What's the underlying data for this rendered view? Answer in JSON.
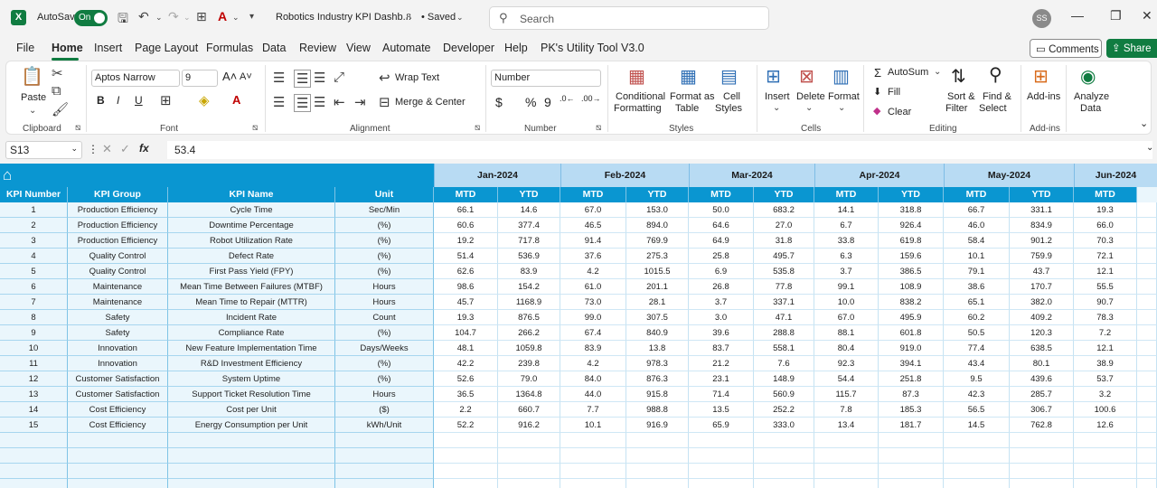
{
  "titlebar": {
    "autosave_label": "AutoSave",
    "toggle_label": "On",
    "title": "Robotics Industry KPI Dashb...",
    "saved": "• Saved",
    "search_placeholder": "Search",
    "avatar_initials": "SS"
  },
  "tabs": [
    "File",
    "Home",
    "Insert",
    "Page Layout",
    "Formulas",
    "Data",
    "Review",
    "View",
    "Automate",
    "Developer",
    "Help",
    "PK's Utility Tool V3.0"
  ],
  "active_tab": "Home",
  "comments_label": "Comments",
  "share_label": "Share",
  "ribbon": {
    "paste": "Paste",
    "font_name": "Aptos Narrow",
    "font_size": "9",
    "wrap_text": "Wrap Text",
    "merge_center": "Merge & Center",
    "number_format": "Number",
    "conditional_formatting": [
      "Conditional",
      "Formatting"
    ],
    "format_as_table": [
      "Format as",
      "Table"
    ],
    "cell_styles": [
      "Cell",
      "Styles"
    ],
    "insert": "Insert",
    "delete": "Delete",
    "format": "Format",
    "autosum": "AutoSum",
    "fill": "Fill",
    "clear": "Clear",
    "sort_filter": [
      "Sort &",
      "Filter"
    ],
    "find_select": [
      "Find &",
      "Select"
    ],
    "addins": "Add-ins",
    "analyze_data": [
      "Analyze",
      "Data"
    ],
    "groups": [
      "Clipboard",
      "Font",
      "Alignment",
      "Number",
      "Styles",
      "Cells",
      "Editing",
      "Add-ins"
    ]
  },
  "formula_bar": {
    "cell_ref": "S13",
    "value": "53.4"
  },
  "table": {
    "months": [
      "Jan-2024",
      "Feb-2024",
      "Mar-2024",
      "Apr-2024",
      "May-2024",
      "Jun-2024"
    ],
    "headers": [
      "KPI Number",
      "KPI Group",
      "KPI Name",
      "Unit"
    ],
    "sub_headers": [
      "MTD",
      "YTD",
      "MTD",
      "YTD",
      "MTD",
      "YTD",
      "MTD",
      "YTD",
      "MTD",
      "YTD",
      "MTD"
    ],
    "rows": [
      [
        "1",
        "Production Efficiency",
        "Cycle Time",
        "Sec/Min",
        "66.1",
        "14.6",
        "67.0",
        "153.0",
        "50.0",
        "683.2",
        "14.1",
        "318.8",
        "66.7",
        "331.1",
        "19.3"
      ],
      [
        "2",
        "Production Efficiency",
        "Downtime Percentage",
        "(%)",
        "60.6",
        "377.4",
        "46.5",
        "894.0",
        "64.6",
        "27.0",
        "6.7",
        "926.4",
        "46.0",
        "834.9",
        "66.0"
      ],
      [
        "3",
        "Production Efficiency",
        "Robot Utilization Rate",
        "(%)",
        "19.2",
        "717.8",
        "91.4",
        "769.9",
        "64.9",
        "31.8",
        "33.8",
        "619.8",
        "58.4",
        "901.2",
        "70.3"
      ],
      [
        "4",
        "Quality Control",
        "Defect Rate",
        "(%)",
        "51.4",
        "536.9",
        "37.6",
        "275.3",
        "25.8",
        "495.7",
        "6.3",
        "159.6",
        "10.1",
        "759.9",
        "72.1"
      ],
      [
        "5",
        "Quality Control",
        "First Pass Yield (FPY)",
        "(%)",
        "62.6",
        "83.9",
        "4.2",
        "1015.5",
        "6.9",
        "535.8",
        "3.7",
        "386.5",
        "79.1",
        "43.7",
        "12.1"
      ],
      [
        "6",
        "Maintenance",
        "Mean Time Between Failures (MTBF)",
        "Hours",
        "98.6",
        "154.2",
        "61.0",
        "201.1",
        "26.8",
        "77.8",
        "99.1",
        "108.9",
        "38.6",
        "170.7",
        "55.5"
      ],
      [
        "7",
        "Maintenance",
        "Mean Time to Repair (MTTR)",
        "Hours",
        "45.7",
        "1168.9",
        "73.0",
        "28.1",
        "3.7",
        "337.1",
        "10.0",
        "838.2",
        "65.1",
        "382.0",
        "90.7"
      ],
      [
        "8",
        "Safety",
        "Incident Rate",
        "Count",
        "19.3",
        "876.5",
        "99.0",
        "307.5",
        "3.0",
        "47.1",
        "67.0",
        "495.9",
        "60.2",
        "409.2",
        "78.3"
      ],
      [
        "9",
        "Safety",
        "Compliance Rate",
        "(%)",
        "104.7",
        "266.2",
        "67.4",
        "840.9",
        "39.6",
        "288.8",
        "88.1",
        "601.8",
        "50.5",
        "120.3",
        "7.2"
      ],
      [
        "10",
        "Innovation",
        "New Feature Implementation Time",
        "Days/Weeks",
        "48.1",
        "1059.8",
        "83.9",
        "13.8",
        "83.7",
        "558.1",
        "80.4",
        "919.0",
        "77.4",
        "638.5",
        "12.1"
      ],
      [
        "11",
        "Innovation",
        "R&D Investment Efficiency",
        "(%)",
        "42.2",
        "239.8",
        "4.2",
        "978.3",
        "21.2",
        "7.6",
        "92.3",
        "394.1",
        "43.4",
        "80.1",
        "38.9"
      ],
      [
        "12",
        "Customer Satisfaction",
        "System Uptime",
        "(%)",
        "52.6",
        "79.0",
        "84.0",
        "876.3",
        "23.1",
        "148.9",
        "54.4",
        "251.8",
        "9.5",
        "439.6",
        "53.7"
      ],
      [
        "13",
        "Customer Satisfaction",
        "Support Ticket Resolution Time",
        "Hours",
        "36.5",
        "1364.8",
        "44.0",
        "915.8",
        "71.4",
        "560.9",
        "115.7",
        "87.3",
        "42.3",
        "285.7",
        "3.2"
      ],
      [
        "14",
        "Cost Efficiency",
        "Cost per Unit",
        "($)",
        "2.2",
        "660.7",
        "7.7",
        "988.8",
        "13.5",
        "252.2",
        "7.8",
        "185.3",
        "56.5",
        "306.7",
        "100.6"
      ],
      [
        "15",
        "Cost Efficiency",
        "Energy Consumption per Unit",
        "kWh/Unit",
        "52.2",
        "916.2",
        "10.1",
        "916.9",
        "65.9",
        "333.0",
        "13.4",
        "181.7",
        "14.5",
        "762.8",
        "12.6"
      ]
    ],
    "empty_rows": 4
  }
}
